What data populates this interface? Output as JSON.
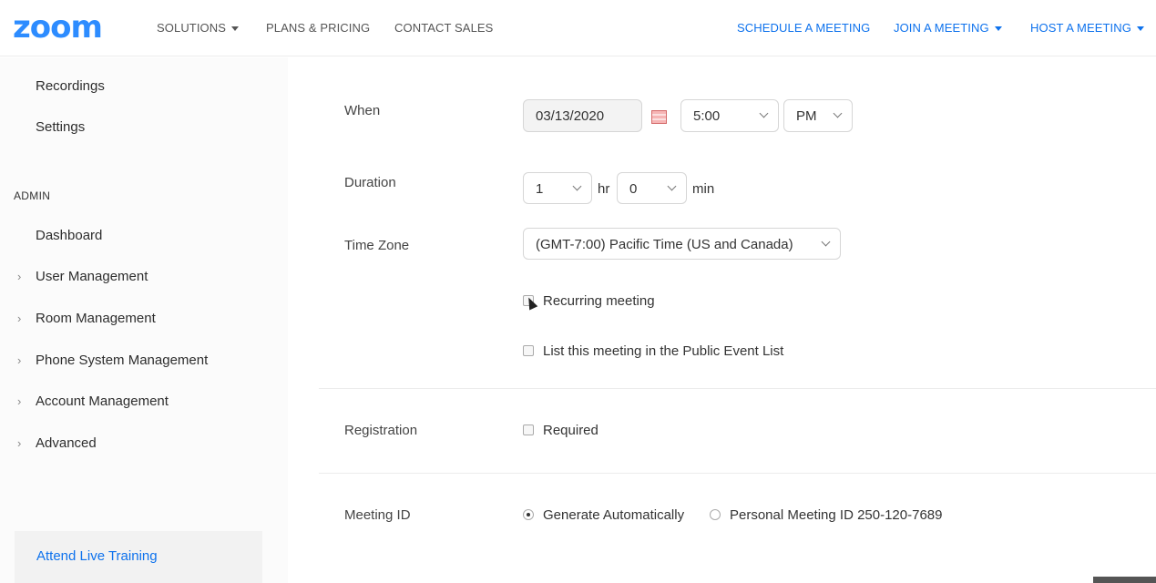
{
  "header": {
    "logo": "zoom",
    "nav_left": [
      {
        "label": "SOLUTIONS",
        "dropdown": true
      },
      {
        "label": "PLANS & PRICING"
      },
      {
        "label": "CONTACT SALES"
      }
    ],
    "nav_right": [
      {
        "label": "SCHEDULE A MEETING"
      },
      {
        "label": "JOIN A MEETING",
        "dropdown": true
      },
      {
        "label": "HOST A MEETING",
        "dropdown": true
      }
    ]
  },
  "sidebar": {
    "top_items": [
      "Recordings",
      "Settings"
    ],
    "admin_heading": "ADMIN",
    "dashboard": "Dashboard",
    "admin_items": [
      "User Management",
      "Room Management",
      "Phone System Management",
      "Account Management",
      "Advanced"
    ],
    "training": "Attend Live Training"
  },
  "form": {
    "when": {
      "label": "When",
      "date": "03/13/2020",
      "time": "5:00",
      "ampm": "PM"
    },
    "duration": {
      "label": "Duration",
      "hours": "1",
      "hr_unit": "hr",
      "minutes": "0",
      "min_unit": "min"
    },
    "timezone": {
      "label": "Time Zone",
      "value": "(GMT-7:00) Pacific Time (US and Canada)"
    },
    "recurring": {
      "label": "Recurring meeting",
      "checked": false
    },
    "public_list": {
      "label": "List this meeting in the Public Event List",
      "checked": false
    },
    "registration": {
      "label": "Registration",
      "option": "Required",
      "checked": false
    },
    "meeting_id": {
      "label": "Meeting ID",
      "options": [
        "Generate Automatically",
        "Personal Meeting ID 250-120-7689"
      ],
      "selected": "Generate Automatically"
    }
  },
  "colors": {
    "brand": "#2d8cff",
    "link": "#0e72ed"
  }
}
